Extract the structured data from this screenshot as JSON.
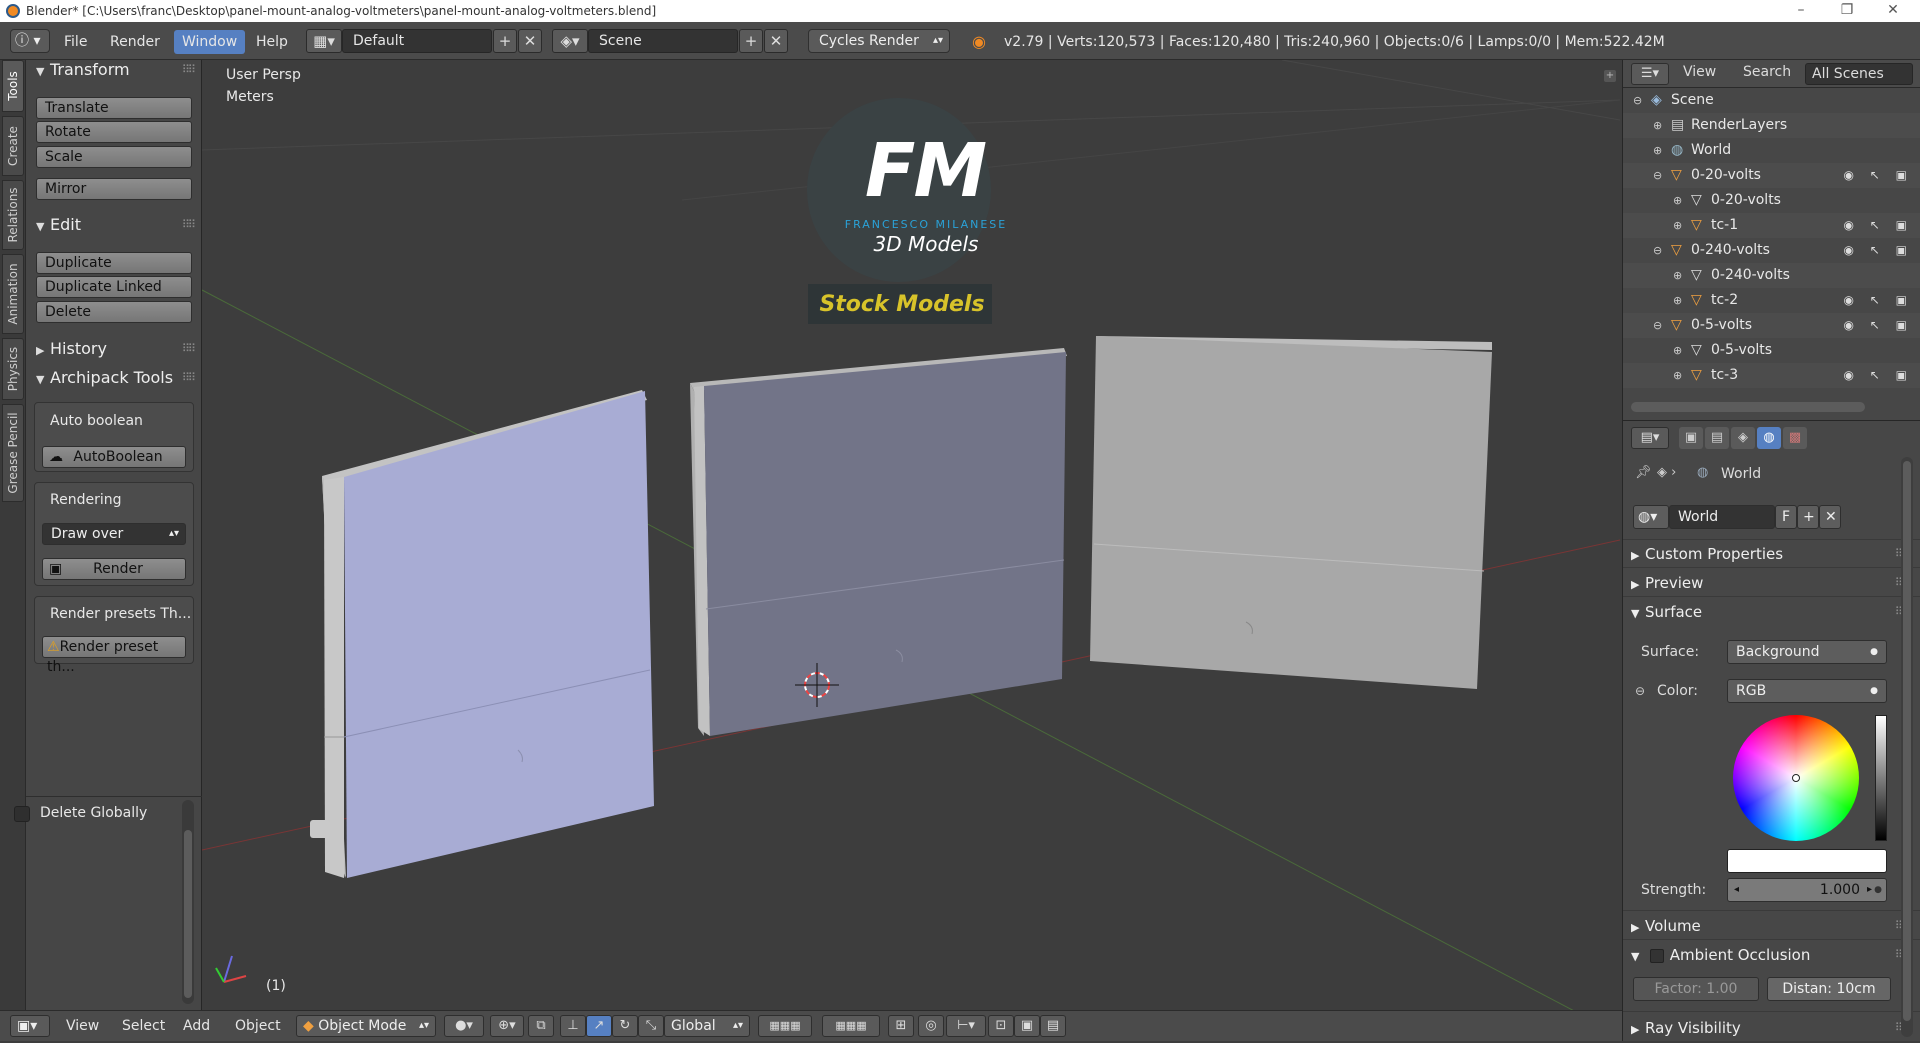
{
  "window": {
    "title": "Blender* [C:\\Users\\franc\\Desktop\\panel-mount-analog-voltmeters\\panel-mount-analog-voltmeters.blend]",
    "minimize": "–",
    "maximize": "❐",
    "close": "✕"
  },
  "topbar": {
    "menus": [
      "File",
      "Render",
      "Window",
      "Help"
    ],
    "screen_layout": "Default",
    "scene": "Scene",
    "render_engine": "Cycles Render",
    "stats": "v2.79 | Verts:120,573 | Faces:120,480 | Tris:240,960 | Objects:0/6 | Lamps:0/0 | Mem:522.42M"
  },
  "tabs": [
    "Tools",
    "Create",
    "Relations",
    "Animation",
    "Physics",
    "Grease Pencil"
  ],
  "toolshelf": {
    "transform_title": "Transform",
    "transform_buttons": [
      "Translate",
      "Rotate",
      "Scale"
    ],
    "mirror": "Mirror",
    "edit_title": "Edit",
    "edit_buttons": [
      "Duplicate",
      "Duplicate Linked",
      "Delete"
    ],
    "history_title": "History",
    "archipack_title": "Archipack Tools",
    "auto_boolean_label": "Auto boolean",
    "auto_boolean_button": "AutoBoolean",
    "rendering_label": "Rendering",
    "draw_mode": "Draw over",
    "render_button": "Render",
    "render_presets_label": "Render presets Th...",
    "render_preset_warning": "Render preset th...",
    "delete_globally": "Delete Globally"
  },
  "viewport": {
    "view_name": "User Persp",
    "units": "Meters",
    "frame": "(1)",
    "watermark": {
      "logo": "FM",
      "author": "FRANCESCO MILANESE",
      "subtitle": "3D Models",
      "banner": "Stock Models"
    }
  },
  "bottombar": {
    "menus": [
      "View",
      "Select",
      "Add",
      "Object"
    ],
    "mode": "Object Mode",
    "orientation": "Global"
  },
  "outliner": {
    "header": [
      "View",
      "Search",
      "All Scenes"
    ],
    "rows": [
      {
        "label": "Scene",
        "indent": 0,
        "type": "scene"
      },
      {
        "label": "RenderLayers",
        "indent": 1,
        "type": "renderlayers"
      },
      {
        "label": "World",
        "indent": 1,
        "type": "world"
      },
      {
        "label": "0-20-volts",
        "indent": 1,
        "type": "object"
      },
      {
        "label": "0-20-volts",
        "indent": 2,
        "type": "mesh"
      },
      {
        "label": "tc-1",
        "indent": 2,
        "type": "object"
      },
      {
        "label": "0-240-volts",
        "indent": 1,
        "type": "object"
      },
      {
        "label": "0-240-volts",
        "indent": 2,
        "type": "mesh"
      },
      {
        "label": "tc-2",
        "indent": 2,
        "type": "object"
      },
      {
        "label": "0-5-volts",
        "indent": 1,
        "type": "object"
      },
      {
        "label": "0-5-volts",
        "indent": 2,
        "type": "mesh"
      },
      {
        "label": "tc-3",
        "indent": 2,
        "type": "object"
      }
    ]
  },
  "properties": {
    "context": "World",
    "datablock": "World",
    "fake_user": "F",
    "panels": [
      "Custom Properties",
      "Preview",
      "Surface"
    ],
    "surface_label": "Surface:",
    "surface_value": "Background",
    "color_label": "Color:",
    "color_mode": "RGB",
    "strength_label": "Strength:",
    "strength_value": "1.000",
    "volume": "Volume",
    "ambient_occlusion": "Ambient Occlusion",
    "factor": "Factor: 1.00",
    "distance": "Distan: 10cm",
    "ray_visibility": "Ray Visibility"
  },
  "colors": {
    "accent": "#5680c2",
    "panel_front_1": "#a4a8cf",
    "panel_front_2": "#6d6e82",
    "panel_front_3": "#a8a8a8",
    "banner_text": "#d8c32a",
    "logo_blue": "#2aa2d8"
  }
}
